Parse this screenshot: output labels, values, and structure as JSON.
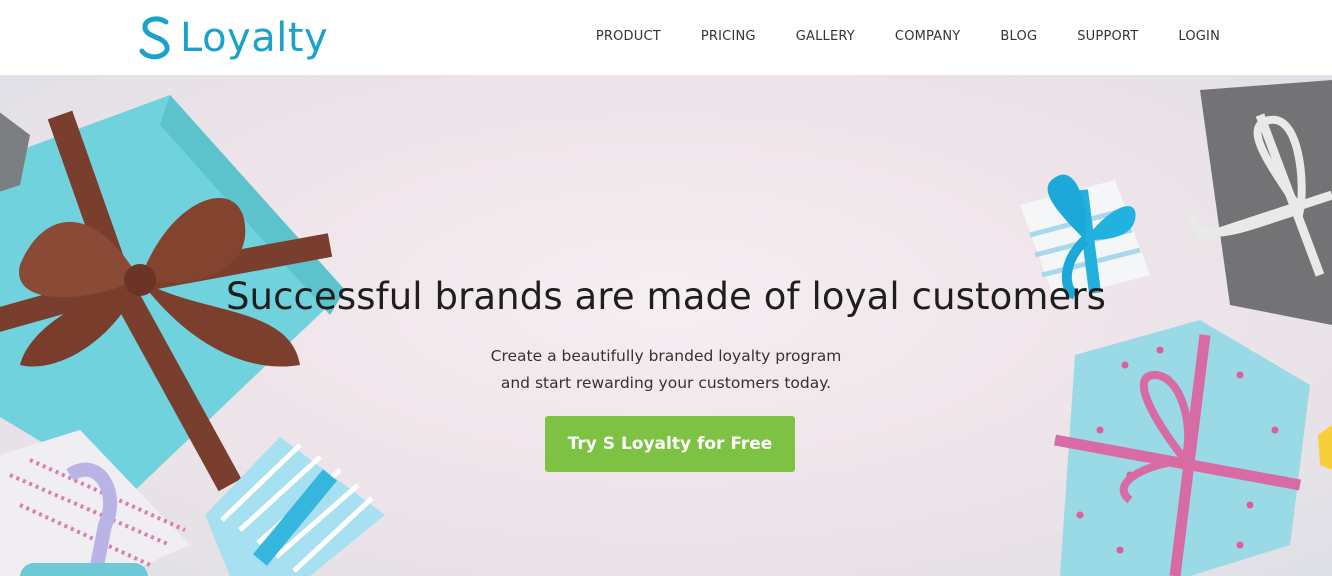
{
  "header": {
    "logo_text": "Loyalty",
    "logo_mark": "S",
    "nav": [
      "PRODUCT",
      "PRICING",
      "GALLERY",
      "COMPANY",
      "BLOG",
      "SUPPORT",
      "LOGIN"
    ]
  },
  "hero": {
    "headline": "Successful brands are made of loyal customers",
    "sub_line1": "Create a beautifully branded loyalty program",
    "sub_line2": "and start rewarding your customers today.",
    "cta_label": "Try S Loyalty for Free"
  },
  "colors": {
    "brand": "#1aa3c9",
    "cta": "#7dc243",
    "text": "#1e1e1e"
  }
}
